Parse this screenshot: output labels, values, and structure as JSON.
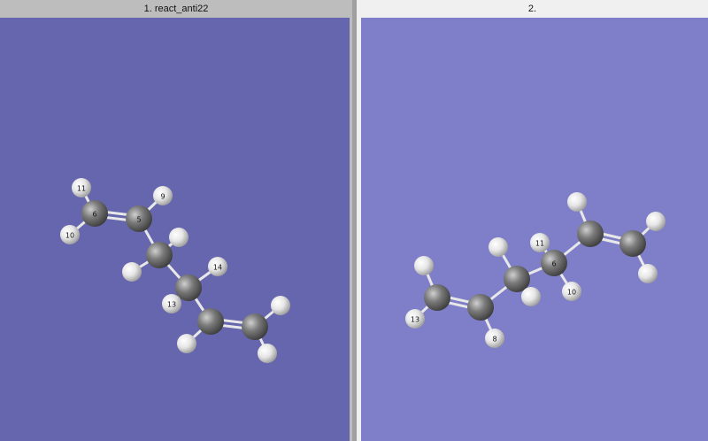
{
  "windows": [
    {
      "title": "1. react_anti22",
      "atom_labels": {
        "h11": "11",
        "c6": "6",
        "h10": "10",
        "c5": "5",
        "h9": "9",
        "h14": "14",
        "h13": "13"
      }
    },
    {
      "title": "2.",
      "atom_labels": {
        "h13": "13",
        "h8": "8",
        "h11": "11",
        "c6": "6",
        "h10": "10"
      }
    }
  ],
  "colors": {
    "left_background": "#6666ae",
    "right_background": "#7f7fc9",
    "carbon": "#808080",
    "hydrogen": "#f0f0f0"
  }
}
